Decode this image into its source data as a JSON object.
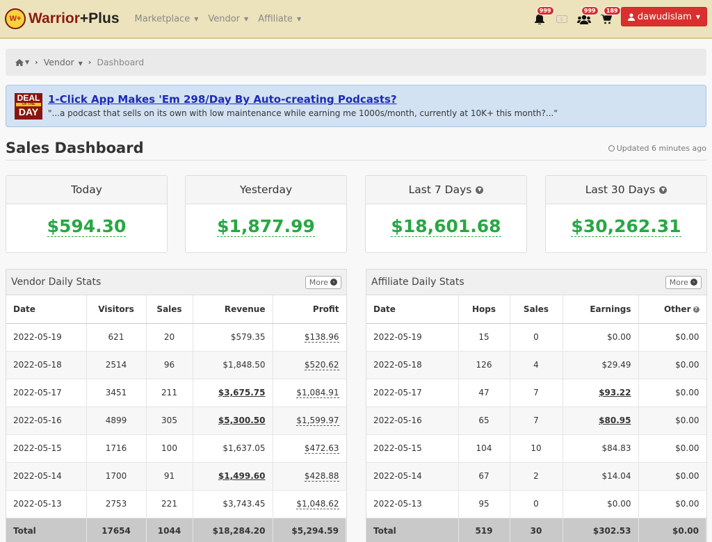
{
  "brand": {
    "badge": "W+",
    "name_main": "Warrior",
    "name_plus": "+Plus"
  },
  "nav": {
    "items": [
      {
        "label": "Marketplace"
      },
      {
        "label": "Vendor"
      },
      {
        "label": "Affiliate"
      }
    ]
  },
  "notifications": {
    "bell_count": "999",
    "users_count": "999",
    "cart_count": "189"
  },
  "user": {
    "name": "dawudislam"
  },
  "breadcrumb": {
    "vendor": "Vendor",
    "current": "Dashboard"
  },
  "deal": {
    "badge_top": "DEAL",
    "badge_mid": "OF THE",
    "badge_bottom": "DAY",
    "title": "1-Click App Makes 'Em 298/Day By Auto-creating Podcasts?",
    "subtitle": "\"...a podcast that sells on its own with low maintenance while earning me 1000s/month, currently at 10K+ this month?...\""
  },
  "dashboard": {
    "title": "Sales Dashboard",
    "updated": "Updated 6 minutes ago"
  },
  "cards": [
    {
      "label": "Today",
      "value": "$594.30"
    },
    {
      "label": "Yesterday",
      "value": "$1,877.99"
    },
    {
      "label": "Last 7 Days",
      "value": "$18,601.68"
    },
    {
      "label": "Last 30 Days",
      "value": "$30,262.31"
    }
  ],
  "vendor_stats": {
    "title": "Vendor Daily Stats",
    "more_label": "More",
    "headers": [
      "Date",
      "Visitors",
      "Sales",
      "Revenue",
      "Profit"
    ],
    "rows": [
      [
        "2022-05-19",
        "621",
        "20",
        "$579.35",
        "$138.96"
      ],
      [
        "2022-05-18",
        "2514",
        "96",
        "$1,848.50",
        "$520.62"
      ],
      [
        "2022-05-17",
        "3451",
        "211",
        "$3,675.75",
        "$1,084.91"
      ],
      [
        "2022-05-16",
        "4899",
        "305",
        "$5,300.50",
        "$1,599.97"
      ],
      [
        "2022-05-15",
        "1716",
        "100",
        "$1,637.05",
        "$472.63"
      ],
      [
        "2022-05-14",
        "1700",
        "91",
        "$1,499.60",
        "$428.88"
      ],
      [
        "2022-05-13",
        "2753",
        "221",
        "$3,743.45",
        "$1,048.62"
      ]
    ],
    "total": [
      "Total",
      "17654",
      "1044",
      "$18,284.20",
      "$5,294.59"
    ]
  },
  "affiliate_stats": {
    "title": "Affiliate Daily Stats",
    "more_label": "More",
    "headers": [
      "Date",
      "Hops",
      "Sales",
      "Earnings",
      "Other"
    ],
    "rows": [
      [
        "2022-05-19",
        "15",
        "0",
        "$0.00",
        "$0.00"
      ],
      [
        "2022-05-18",
        "126",
        "4",
        "$29.49",
        "$0.00"
      ],
      [
        "2022-05-17",
        "47",
        "7",
        "$93.22",
        "$0.00"
      ],
      [
        "2022-05-16",
        "65",
        "7",
        "$80.95",
        "$0.00"
      ],
      [
        "2022-05-15",
        "104",
        "10",
        "$84.83",
        "$0.00"
      ],
      [
        "2022-05-14",
        "67",
        "2",
        "$14.04",
        "$0.00"
      ],
      [
        "2022-05-13",
        "95",
        "0",
        "$0.00",
        "$0.00"
      ]
    ],
    "total": [
      "Total",
      "519",
      "30",
      "$302.53",
      "$0.00"
    ]
  }
}
